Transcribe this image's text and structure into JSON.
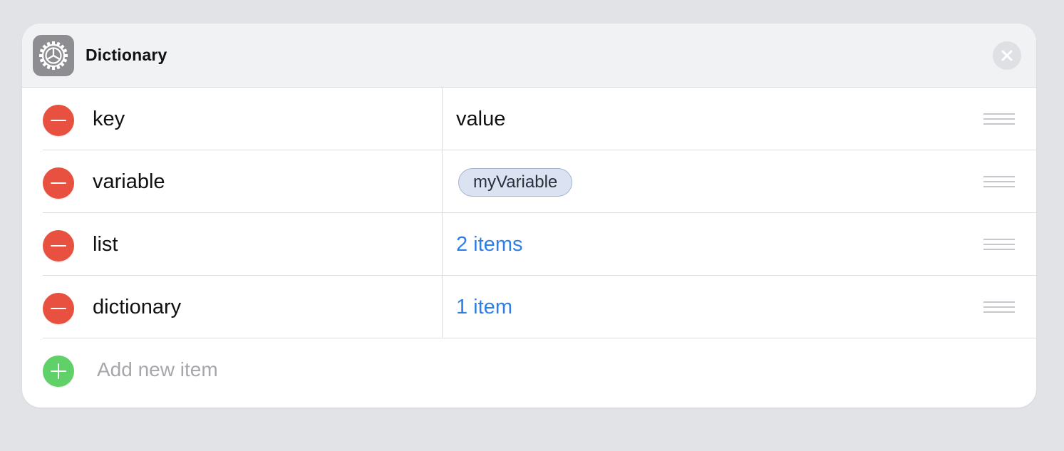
{
  "header": {
    "title": "Dictionary",
    "icon": "gear-icon",
    "close_icon": "close-icon"
  },
  "rows": [
    {
      "key": "key",
      "value": "value",
      "value_type": "text"
    },
    {
      "key": "variable",
      "value": "myVariable",
      "value_type": "variable-token"
    },
    {
      "key": "list",
      "value": "2 items",
      "value_type": "link"
    },
    {
      "key": "dictionary",
      "value": "1 item",
      "value_type": "link"
    }
  ],
  "add_item": {
    "label": "Add new item"
  },
  "colors": {
    "delete": "#e85140",
    "add": "#5fd168",
    "link": "#2f7ee6",
    "token_bg": "#dbe3f3",
    "icon_bg": "#8e8e92"
  }
}
